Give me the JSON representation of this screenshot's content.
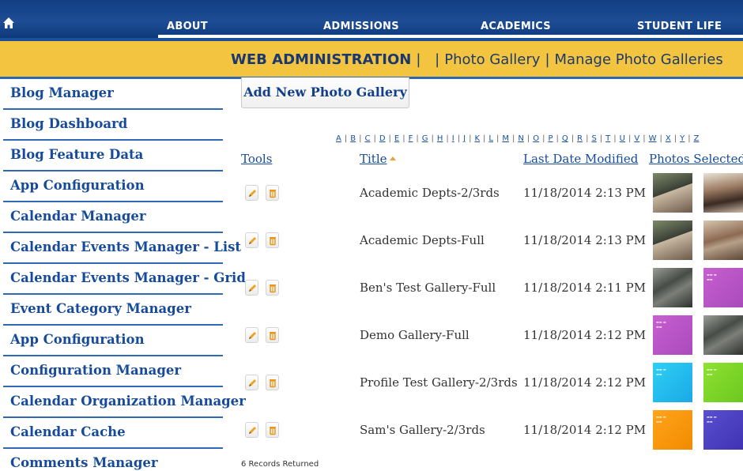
{
  "nav": {
    "home_icon": "home-icon",
    "items": [
      "ABOUT",
      "ADMISSIONS",
      "ACADEMICS",
      "STUDENT LIFE"
    ]
  },
  "banner": {
    "section": "WEB ADMINISTRATION",
    "separator": "|",
    "crumb": "Photo Gallery",
    "page": "Manage Photo Galleries"
  },
  "sidebar": {
    "items": [
      "Blog Manager",
      "Blog Dashboard",
      "Blog Feature Data",
      "App Configuration",
      "Calendar Manager",
      "Calendar Events Manager - List",
      "Calendar Events Manager - Grid",
      "Event Category Manager",
      "App Configuration",
      "Configuration Manager",
      "Calendar Organization Manager",
      "Calendar Cache",
      "Comments Manager"
    ]
  },
  "main": {
    "add_button": "Add New Photo Gallery",
    "letters": [
      "A",
      "B",
      "C",
      "D",
      "E",
      "F",
      "G",
      "H",
      "I",
      "J",
      "K",
      "L",
      "M",
      "N",
      "O",
      "P",
      "Q",
      "R",
      "S",
      "T",
      "U",
      "V",
      "W",
      "X",
      "Y",
      "Z"
    ],
    "headers": {
      "tools": "Tools",
      "title": "Title",
      "date": "Last Date Modified",
      "photos": "Photos Selected"
    },
    "sort_icon": "sort-ascending-icon",
    "tool_icons": [
      "edit-pencil-icon",
      "delete-trash-icon"
    ],
    "rows": [
      {
        "title": "Academic Depts-2/3rds",
        "date": "11/18/2014 2:13 PM"
      },
      {
        "title": "Academic Depts-Full",
        "date": "11/18/2014 2:13 PM"
      },
      {
        "title": "Ben's Test Gallery-Full",
        "date": "11/18/2014 2:11 PM"
      },
      {
        "title": "Demo Gallery-Full",
        "date": "11/18/2014 2:12 PM"
      },
      {
        "title": "Profile Test Gallery-2/3rds",
        "date": "11/18/2014 2:12 PM"
      },
      {
        "title": "Sam's Gallery-2/3rds",
        "date": "11/18/2014 2:12 PM"
      }
    ],
    "records": "6 Records Returned"
  },
  "colors": {
    "nav_blue": "#1d4d95",
    "banner_yellow": "#f2c43f",
    "link_blue": "#164a9a",
    "accent_orange": "#e8a33a"
  }
}
